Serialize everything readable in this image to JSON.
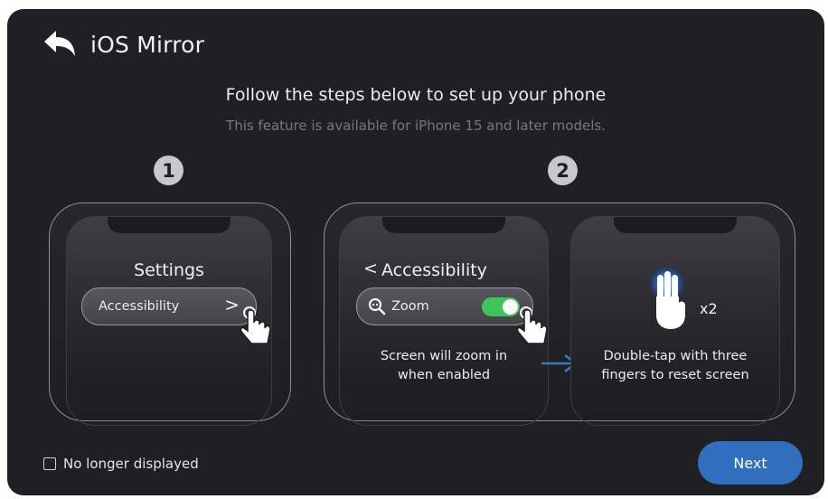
{
  "header": {
    "title": "iOS Mirror",
    "back_icon": "back-arrow-icon"
  },
  "intro": {
    "headline": "Follow the steps below to set up your phone",
    "subtitle": "This feature is available for iPhone 15 and later models."
  },
  "steps": [
    {
      "number": "1",
      "phone": {
        "title": "Settings",
        "row_label": "Accessibility",
        "row_chevron": ">"
      }
    },
    {
      "number": "2",
      "phone_a": {
        "back_chevron": "<",
        "title": "Accessibility",
        "row_label": "Zoom",
        "row_icon": "zoom-magnifier-icon",
        "toggle_on": true,
        "caption_line1": "Screen will zoom in",
        "caption_line2": "when enabled"
      },
      "phone_b": {
        "gesture_icon": "three-finger-tap-icon",
        "tap_count": "x2",
        "caption_line1": "Double-tap with three",
        "caption_line2": "fingers to reset screen"
      }
    }
  ],
  "footer": {
    "dont_show_label": "No longer displayed",
    "next_label": "Next"
  },
  "colors": {
    "background": "#202024",
    "accent": "#2f6fbd",
    "toggle_on": "#3ec45a",
    "arrow": "#3a78c4"
  }
}
